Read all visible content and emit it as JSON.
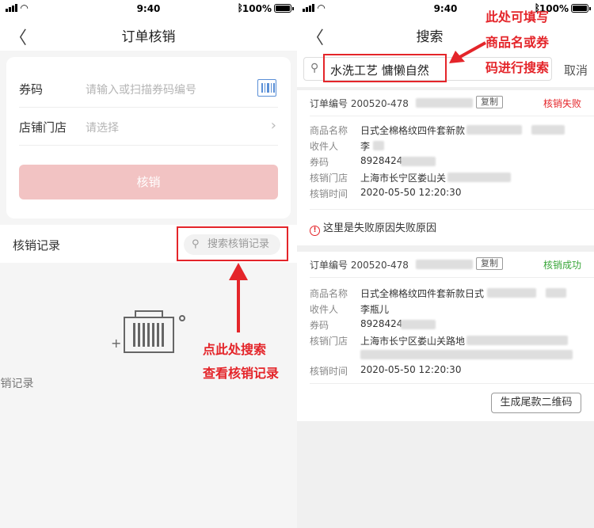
{
  "status": {
    "time": "9:40",
    "battery": "100%"
  },
  "left": {
    "title": "订单核销",
    "coupon_label": "券码",
    "coupon_placeholder": "请输入或扫描券码编号",
    "store_label": "店铺门店",
    "store_placeholder": "请选择",
    "verify_button": "核销",
    "record_label": "核销记录",
    "search_record_placeholder": "搜索核销记录",
    "empty_text": "暂无核销记录",
    "annotation_line1": "点此处搜索",
    "annotation_line2": "查看核销记录"
  },
  "right": {
    "title": "搜索",
    "search_value": "水洗工艺 慵懒自然",
    "cancel": "取消",
    "annotation_line1": "此处可填写",
    "annotation_line2": "商品名或券",
    "annotation_line3": "码进行搜索",
    "labels": {
      "order_no": "订单编号",
      "copy": "复制",
      "product": "商品名称",
      "receiver": "收件人",
      "coupon": "券码",
      "store": "核销门店",
      "time": "核销时间"
    },
    "orders": [
      {
        "order_no": "200520-478",
        "status": "核销失败",
        "product": "日式全棉格纹四件套新款",
        "receiver": "李",
        "coupon": "8928424",
        "store": "上海市长宁区娄山关",
        "time": "2020-05-50 12:20:30",
        "fail_reason": "这里是失败原因失败原因"
      },
      {
        "order_no": "200520-478",
        "status": "核销成功",
        "product": "日式全棉格纹四件套新款日式",
        "receiver": "李瓶儿",
        "coupon": "8928424",
        "store": "上海市长宁区娄山关路地",
        "time": "2020-05-50 12:20:30"
      }
    ],
    "qr_button": "生成尾款二维码"
  },
  "colors": {
    "accent_red": "#e4252a",
    "success_green": "#3aa63a",
    "button_pink": "#f2c3c3",
    "scan_blue": "#5a8fd6"
  }
}
